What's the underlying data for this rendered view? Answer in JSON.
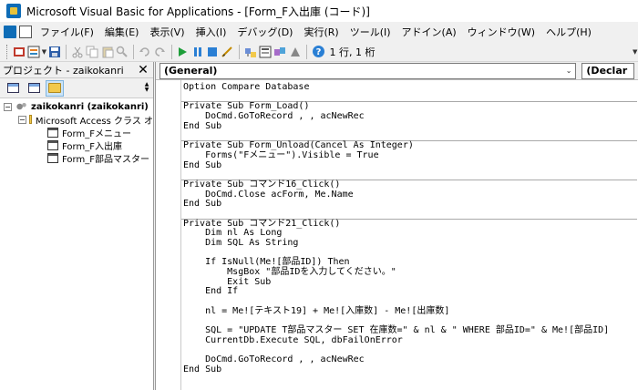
{
  "titlebar": {
    "title": "Microsoft Visual Basic for Applications - [Form_F入出庫 (コード)]"
  },
  "menu": {
    "items": [
      {
        "label": "ファイル(F)"
      },
      {
        "label": "編集(E)"
      },
      {
        "label": "表示(V)"
      },
      {
        "label": "挿入(I)"
      },
      {
        "label": "デバッグ(D)"
      },
      {
        "label": "実行(R)"
      },
      {
        "label": "ツール(I)"
      },
      {
        "label": "アドイン(A)"
      },
      {
        "label": "ウィンドウ(W)"
      },
      {
        "label": "ヘルプ(H)"
      }
    ]
  },
  "toolbar": {
    "position_text": "1 行, 1 桁"
  },
  "project_panel": {
    "title": "プロジェクト - zaikokanri",
    "root_label": "zaikokanri (zaikokanri)",
    "folder_label": "Microsoft Access クラス オ",
    "items": [
      "Form_Fメニュー",
      "Form_F入出庫",
      "Form_F部品マスター"
    ]
  },
  "code_window": {
    "object_dropdown": "(General)",
    "proc_dropdown": "(Declar",
    "lines": [
      "Option Compare Database",
      "---",
      "Private Sub Form_Load()",
      "    DoCmd.GoToRecord , , acNewRec",
      "End Sub",
      "---",
      "Private Sub Form_Unload(Cancel As Integer)",
      "    Forms(\"Fメニュー\").Visible = True",
      "End Sub",
      "---",
      "Private Sub コマンド16_Click()",
      "    DoCmd.Close acForm, Me.Name",
      "End Sub",
      "---",
      "Private Sub コマンド21_Click()",
      "    Dim nl As Long",
      "    Dim SQL As String",
      "",
      "    If IsNull(Me![部品ID]) Then",
      "        MsgBox \"部品IDを入力してください。\"",
      "        Exit Sub",
      "    End If",
      "",
      "    nl = Me![テキスト19] + Me![入庫数] - Me![出庫数]",
      "",
      "    SQL = \"UPDATE T部品マスター SET 在庫数=\" & nl & \" WHERE 部品ID=\" & Me![部品ID]",
      "    CurrentDb.Execute SQL, dbFailOnError",
      "",
      "    DoCmd.GoToRecord , , acNewRec",
      "End Sub"
    ]
  }
}
